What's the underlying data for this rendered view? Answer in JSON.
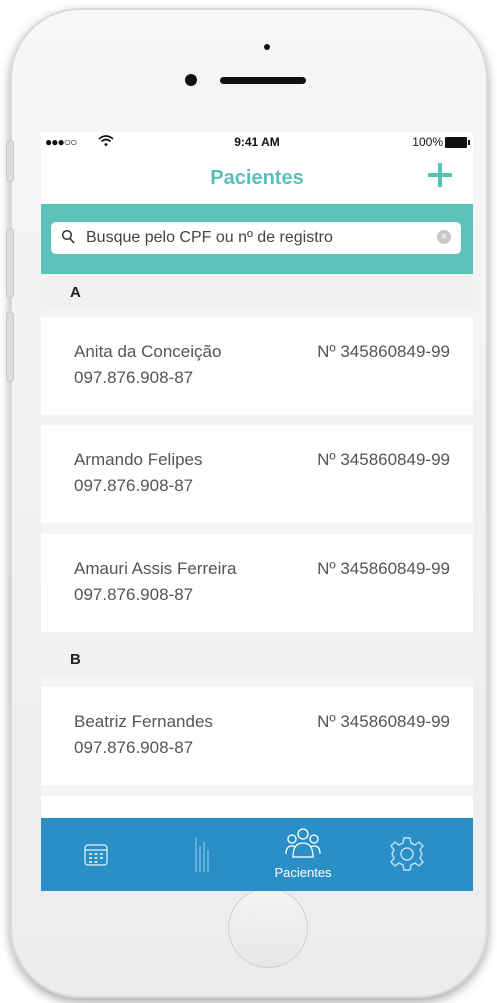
{
  "status": {
    "signal": "●●●○○",
    "time": "9:41 AM",
    "battery": "100%"
  },
  "header": {
    "title": "Pacientes",
    "add_icon": "plus-icon"
  },
  "search": {
    "placeholder": "Busque pelo CPF ou nº de registro",
    "icon": "search-icon",
    "clear_icon": "clear-icon"
  },
  "sections": [
    {
      "letter": "A",
      "patients": [
        {
          "name": "Anita da Conceição",
          "registration": "Nº 345860849-99",
          "cpf": "097.876.908-87"
        },
        {
          "name": "Armando Felipes",
          "registration": "Nº 345860849-99",
          "cpf": "097.876.908-87"
        },
        {
          "name": "Amauri Assis Ferreira",
          "registration": "Nº 345860849-99",
          "cpf": "097.876.908-87"
        }
      ]
    },
    {
      "letter": "B",
      "patients": [
        {
          "name": "Beatriz Fernandes",
          "registration": "Nº 345860849-99",
          "cpf": "097.876.908-87"
        }
      ]
    }
  ],
  "tabbar": {
    "tabs": [
      {
        "icon": "calendar-icon",
        "label": ""
      },
      {
        "icon": "chart-bars-icon",
        "label": ""
      },
      {
        "icon": "patients-icon",
        "label": "Pacientes",
        "active": true
      },
      {
        "icon": "gear-icon",
        "label": ""
      }
    ]
  },
  "colors": {
    "accent": "#57c1b8",
    "search_bg": "#5cc2ba",
    "tabbar_bg": "#2b8fc7"
  }
}
